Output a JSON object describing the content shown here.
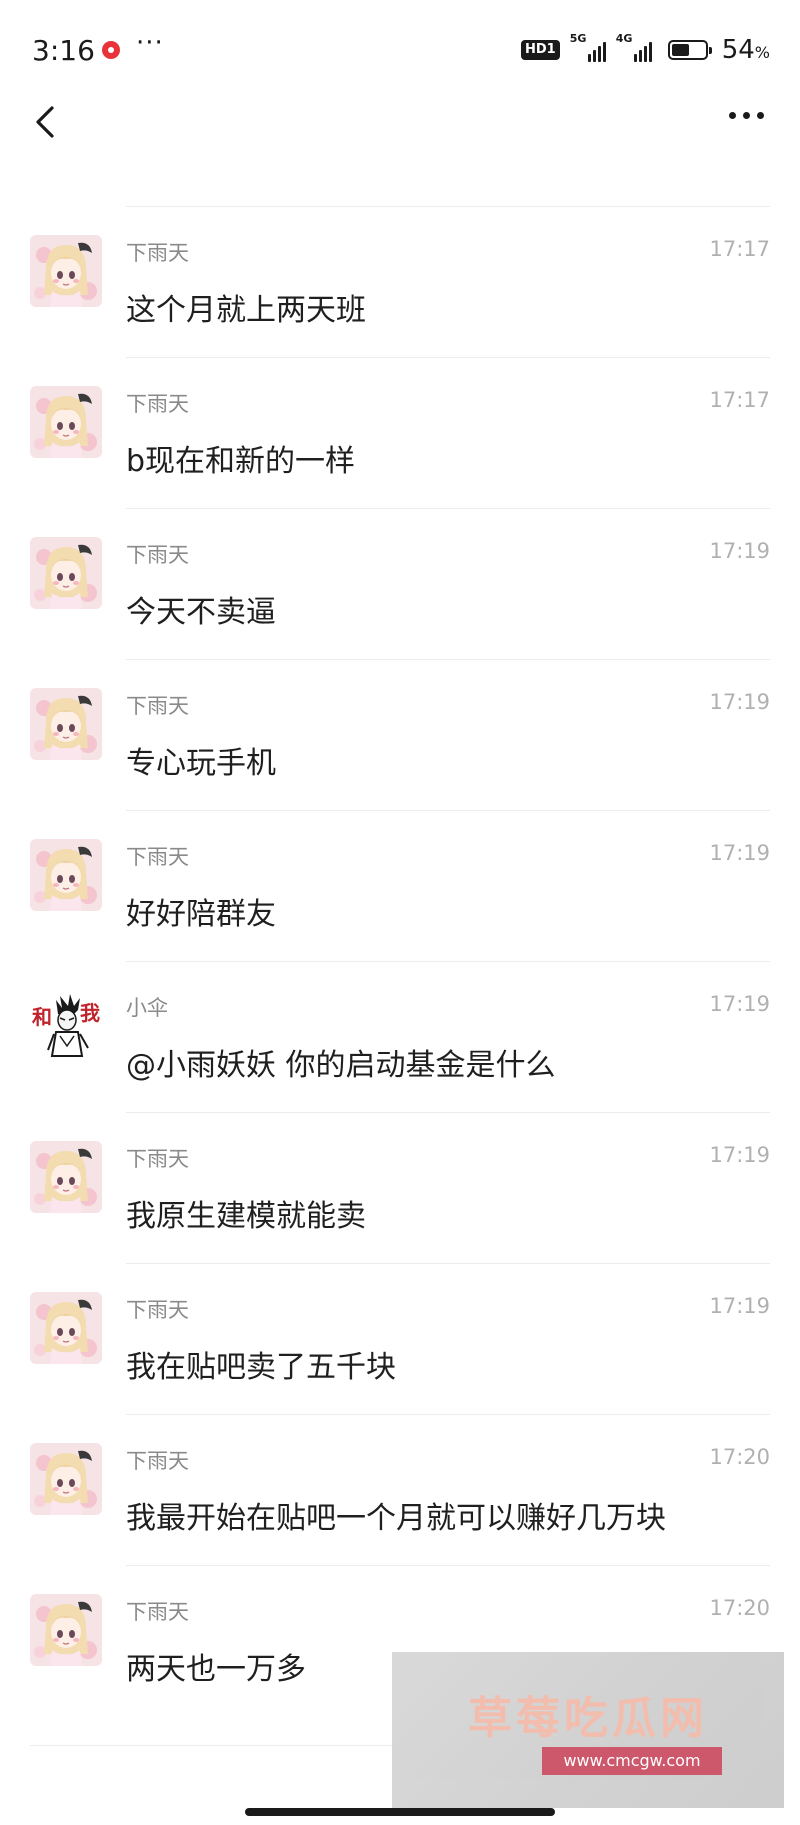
{
  "status_bar": {
    "time": "3:16",
    "more": "···",
    "hd_label": "HD1",
    "signal_1_type": "5G",
    "signal_2_type": "4G",
    "battery_level": 0.54,
    "battery_text": "54",
    "battery_unit": "%"
  },
  "messages": [
    {
      "sender": "下雨天",
      "time": "17:17",
      "text": "这个月就上两天班",
      "avatar": "anime-girl"
    },
    {
      "sender": "下雨天",
      "time": "17:17",
      "text": "b现在和新的一样",
      "avatar": "anime-girl"
    },
    {
      "sender": "下雨天",
      "time": "17:19",
      "text": "今天不卖逼",
      "avatar": "anime-girl"
    },
    {
      "sender": "下雨天",
      "time": "17:19",
      "text": "专心玩手机",
      "avatar": "anime-girl"
    },
    {
      "sender": "下雨天",
      "time": "17:19",
      "text": "好好陪群友",
      "avatar": "anime-girl"
    },
    {
      "sender": "小伞",
      "time": "17:19",
      "text": "@小雨妖妖 你的启动基金是什么",
      "avatar": "ink-character"
    },
    {
      "sender": "下雨天",
      "time": "17:19",
      "text": "我原生建模就能卖",
      "avatar": "anime-girl"
    },
    {
      "sender": "下雨天",
      "time": "17:19",
      "text": "我在贴吧卖了五千块",
      "avatar": "anime-girl"
    },
    {
      "sender": "下雨天",
      "time": "17:20",
      "text": "我最开始在贴吧一个月就可以赚好几万块",
      "avatar": "anime-girl"
    },
    {
      "sender": "下雨天",
      "time": "17:20",
      "text": "两天也一万多",
      "avatar": "anime-girl"
    }
  ],
  "watermark": {
    "title": "草莓吃瓜网",
    "url": "www.cmcgw.com"
  },
  "colors": {
    "sender": "#8a8a8a",
    "time": "#b0b0b0",
    "text": "#1f1f1f",
    "divider": "#ececec",
    "watermark_title": "#f2b8a8",
    "watermark_url_bg": "#c94a5f"
  }
}
